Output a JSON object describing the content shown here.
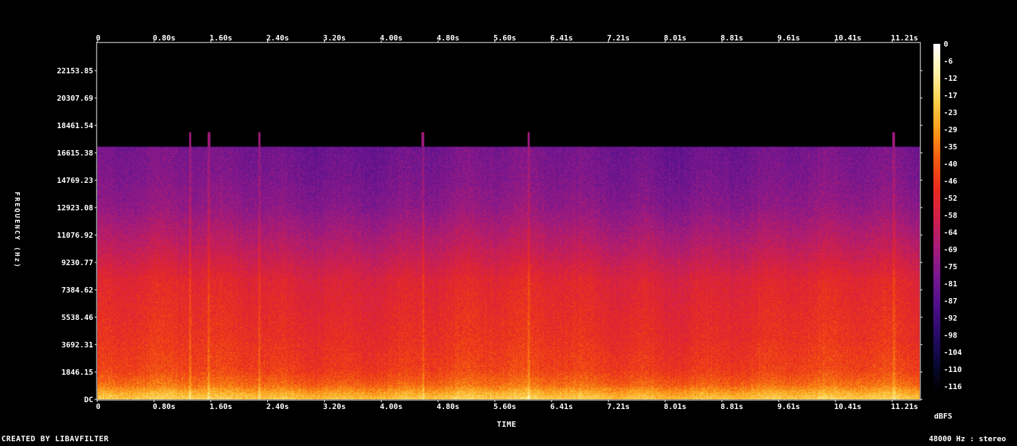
{
  "footer": {
    "credit": "CREATED BY LIBAVFILTER",
    "info": "48000 Hz : stereo"
  },
  "chart_data": {
    "type": "heatmap",
    "xlabel": "TIME",
    "ylabel": "FREQUENCY (Hz)",
    "colorbar_label": "dBFS",
    "x_tick_labels": [
      "0",
      "0.80s",
      "1.60s",
      "2.40s",
      "3.20s",
      "4.00s",
      "4.80s",
      "5.60s",
      "6.41s",
      "7.21s",
      "8.01s",
      "8.81s",
      "9.61s",
      "10.41s",
      "11.21s"
    ],
    "x_ticks_seconds": [
      0,
      0.8,
      1.6,
      2.4,
      3.2,
      4.0,
      4.8,
      5.6,
      6.41,
      7.21,
      8.01,
      8.81,
      9.61,
      10.41,
      11.21
    ],
    "x_range_seconds": [
      0,
      12.0
    ],
    "y_tick_labels": [
      "DC",
      "1846.15",
      "3692.31",
      "5538.46",
      "7384.62",
      "9230.77",
      "11076.92",
      "12923.08",
      "14769.23",
      "16615.38",
      "18461.54",
      "20307.69",
      "22153.85"
    ],
    "y_ticks_hz": [
      0,
      1846.15,
      3692.31,
      5538.46,
      7384.62,
      9230.77,
      11076.92,
      12923.08,
      14769.23,
      16615.38,
      18461.54,
      20307.69,
      22153.85
    ],
    "y_range_hz": [
      0,
      24000
    ],
    "colorbar_tick_labels": [
      "0",
      "-6",
      "-12",
      "-17",
      "-23",
      "-29",
      "-35",
      "-40",
      "-46",
      "-52",
      "-58",
      "-64",
      "-69",
      "-75",
      "-81",
      "-87",
      "-92",
      "-98",
      "-104",
      "-110",
      "-116"
    ],
    "colorbar_range_dbfs": [
      -120,
      0
    ],
    "colormap": [
      "#000000",
      "#0a0a3a",
      "#2a0a6a",
      "#50108a",
      "#7a1890",
      "#a81c78",
      "#d2204a",
      "#ea2b1e",
      "#f45a10",
      "#fa9a18",
      "#fcd04a",
      "#fff2a8",
      "#ffffff"
    ],
    "content_cutoff_hz": 17000,
    "spectrum_profile": [
      {
        "hz": 0,
        "dbfs": -20
      },
      {
        "hz": 500,
        "dbfs": -28
      },
      {
        "hz": 1000,
        "dbfs": -38
      },
      {
        "hz": 2000,
        "dbfs": -46
      },
      {
        "hz": 4000,
        "dbfs": -50
      },
      {
        "hz": 8000,
        "dbfs": -55
      },
      {
        "hz": 10000,
        "dbfs": -64
      },
      {
        "hz": 13000,
        "dbfs": -76
      },
      {
        "hz": 15000,
        "dbfs": -80
      },
      {
        "hz": 17000,
        "dbfs": -82
      },
      {
        "hz": 17200,
        "dbfs": -120
      },
      {
        "hz": 24000,
        "dbfs": -120
      }
    ],
    "transients_seconds": [
      1.35,
      1.62,
      2.36,
      4.75,
      6.29,
      11.62
    ]
  }
}
